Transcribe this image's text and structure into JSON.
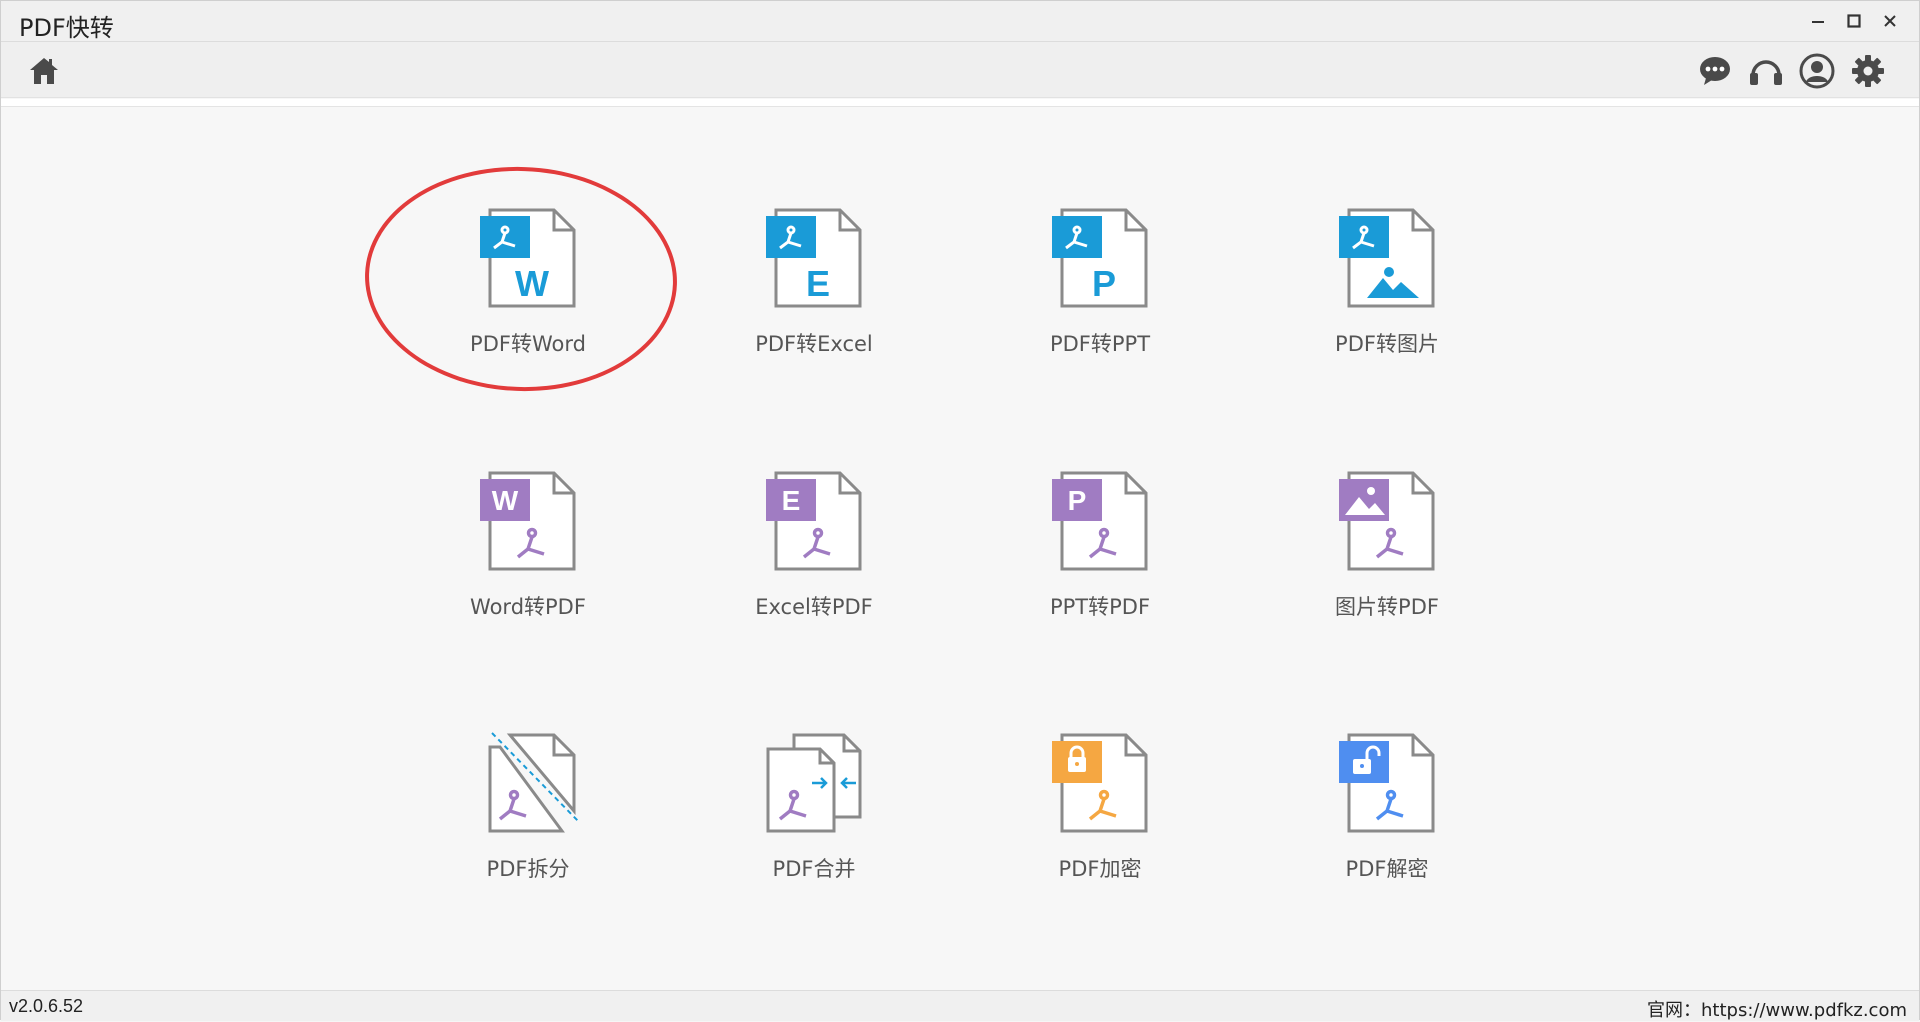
{
  "window": {
    "title": "PDF快转"
  },
  "toolbar": {
    "home": "home-icon",
    "right_icons": [
      "chat-icon",
      "headset-icon",
      "user-icon",
      "gear-icon"
    ]
  },
  "colors": {
    "pdf_source_blue": "#1a9bd7",
    "to_pdf_purple": "#a07cc2",
    "encrypt_orange": "#f5a742",
    "decrypt_blue": "#4f8ef0",
    "highlight_red": "#e23b3b"
  },
  "tools": [
    {
      "label": "PDF转Word",
      "icon": "pdf-to-word-icon",
      "badge": "W"
    },
    {
      "label": "PDF转Excel",
      "icon": "pdf-to-excel-icon",
      "badge": "E"
    },
    {
      "label": "PDF转PPT",
      "icon": "pdf-to-ppt-icon",
      "badge": "P"
    },
    {
      "label": "PDF转图片",
      "icon": "pdf-to-image-icon",
      "badge": ""
    },
    {
      "label": "Word转PDF",
      "icon": "word-to-pdf-icon",
      "badge": "W"
    },
    {
      "label": "Excel转PDF",
      "icon": "excel-to-pdf-icon",
      "badge": "E"
    },
    {
      "label": "PPT转PDF",
      "icon": "ppt-to-pdf-icon",
      "badge": "P"
    },
    {
      "label": "图片转PDF",
      "icon": "image-to-pdf-icon",
      "badge": ""
    },
    {
      "label": "PDF拆分",
      "icon": "pdf-split-icon",
      "badge": ""
    },
    {
      "label": "PDF合并",
      "icon": "pdf-merge-icon",
      "badge": ""
    },
    {
      "label": "PDF加密",
      "icon": "pdf-encrypt-icon",
      "badge": ""
    },
    {
      "label": "PDF解密",
      "icon": "pdf-decrypt-icon",
      "badge": ""
    }
  ],
  "status": {
    "version": "v2.0.6.52",
    "website": "官网：https://www.pdfkz.com"
  }
}
